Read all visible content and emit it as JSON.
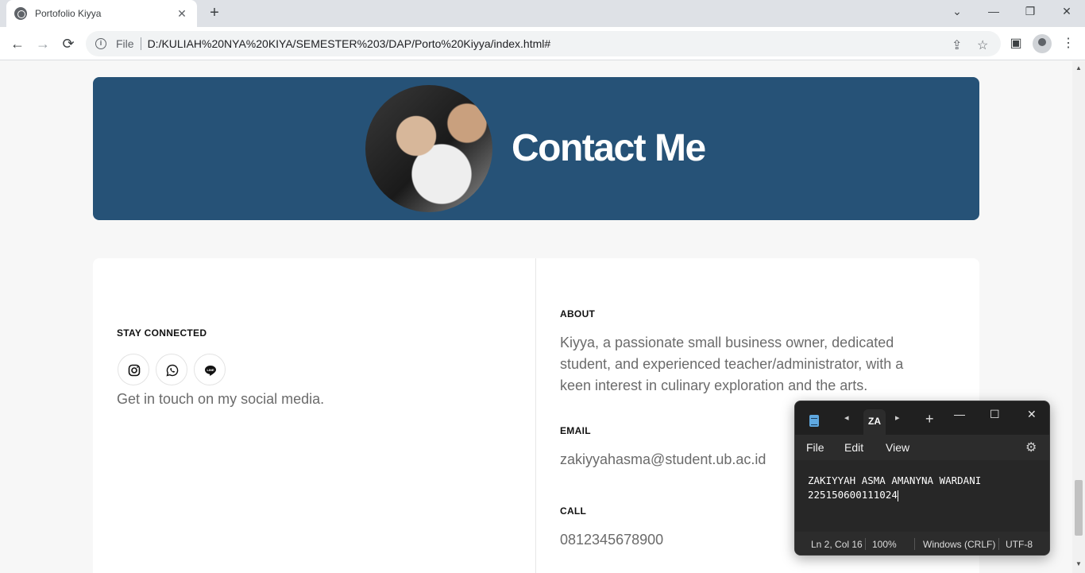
{
  "browser": {
    "tab_title": "Portofolio Kiyya",
    "tab_close_glyph": "✕",
    "new_tab_glyph": "+",
    "url_scheme_label": "File",
    "url": "D:/KULIAH%20NYA%20KIYA/SEMESTER%203/DAP/Porto%20Kiyya/index.html#",
    "back_glyph": "←",
    "forward_glyph": "→",
    "reload_glyph": "⟳",
    "info_glyph": "i",
    "share_glyph": "⇪",
    "bookmark_glyph": "☆",
    "sidepanel_glyph": "▣",
    "menu_glyph": "⋮",
    "window_buttons": {
      "dropdown": "⌄",
      "minimize": "—",
      "restore": "❐",
      "close": "✕"
    }
  },
  "hero": {
    "title": "Contact Me"
  },
  "contact": {
    "stay_connected_heading": "STAY CONNECTED",
    "social_icons": [
      "instagram-icon",
      "whatsapp-icon",
      "line-icon"
    ],
    "social_caption": "Get in touch on my social media.",
    "about_heading": "ABOUT",
    "about_text": "Kiyya, a passionate small business owner, dedicated student, and experienced teacher/administrator, with a keen interest in culinary exploration and the arts.",
    "email_heading": "EMAIL",
    "email_value": "zakiyyahasma@student.ub.ac.id",
    "call_heading": "CALL",
    "call_value": "0812345678900"
  },
  "notepad": {
    "tab_label": "ZA",
    "prev_glyph": "◂",
    "next_glyph": "▸",
    "add_glyph": "+",
    "minimize_glyph": "—",
    "maximize_glyph": "☐",
    "close_glyph": "✕",
    "menu": {
      "file": "File",
      "edit": "Edit",
      "view": "View"
    },
    "settings_glyph": "⚙",
    "line1": "ZAKIYYAH ASMA AMANYNA WARDANI",
    "line2": "225150600111024",
    "status": {
      "position": "Ln 2, Col 16",
      "zoom": "100%",
      "line_ending": "Windows (CRLF)",
      "encoding": "UTF-8"
    }
  },
  "colors": {
    "hero_background": "#265277",
    "page_background": "#f7f7f7",
    "notepad_background": "#202020"
  }
}
